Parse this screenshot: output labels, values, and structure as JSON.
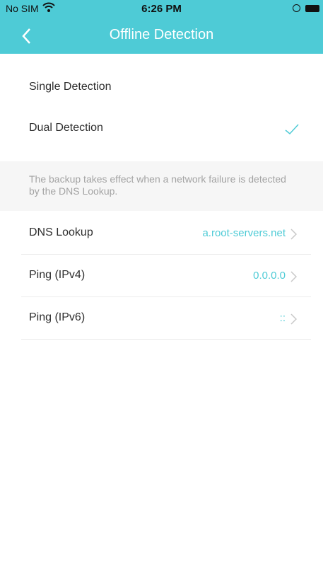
{
  "status": {
    "carrier": "No SIM",
    "time": "6:26 PM",
    "wifi_icon": "wifi-icon",
    "battery_icon": "battery-icon"
  },
  "nav": {
    "title": "Offline Detection",
    "back_icon": "chevron-left-icon"
  },
  "options": [
    {
      "label": "Single Detection",
      "selected": false
    },
    {
      "label": "Dual Detection",
      "selected": true
    }
  ],
  "note": "The backup takes effect when a network failure is detected by the DNS Lookup.",
  "rows": [
    {
      "label": "DNS Lookup",
      "value": "a.root-servers.net"
    },
    {
      "label": "Ping (IPv4)",
      "value": "0.0.0.0"
    },
    {
      "label": "Ping (IPv6)",
      "value": "::"
    }
  ],
  "colors": {
    "accent": "#4ecbd6",
    "text": "#2e2e2e",
    "muted": "#a3a3a3"
  }
}
